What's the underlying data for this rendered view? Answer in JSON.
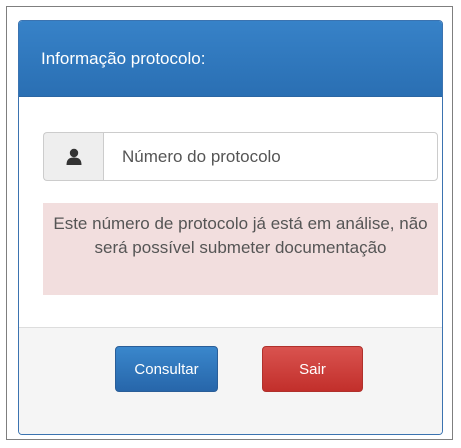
{
  "panel": {
    "title": "Informação protocolo:"
  },
  "protocol_input": {
    "icon": "user-icon",
    "placeholder": "Número do protocolo",
    "value": ""
  },
  "alert": {
    "message": "Este número de protocolo já está em análise, não será possível submeter documentação"
  },
  "buttons": {
    "consult_label": "Consultar",
    "exit_label": "Sair"
  },
  "colors": {
    "header": "#2f79be",
    "alert_bg": "#f2dede",
    "primary": "#2f75bb",
    "danger": "#d43f3a"
  }
}
